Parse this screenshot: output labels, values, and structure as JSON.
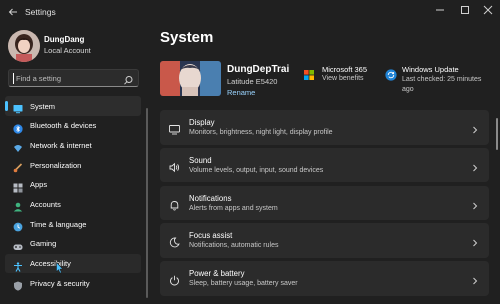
{
  "window": {
    "title": "Settings",
    "back_icon": "back-arrow-icon",
    "controls": [
      "minimize-icon",
      "maximize-icon",
      "close-icon"
    ]
  },
  "profile": {
    "name": "DungDang",
    "account_type": "Local Account"
  },
  "search": {
    "placeholder": "Find a setting"
  },
  "sidebar": {
    "items": [
      {
        "label": "System",
        "icon": "system-icon",
        "color": "#4cc2ff",
        "active": true
      },
      {
        "label": "Bluetooth & devices",
        "icon": "bluetooth-icon",
        "color": "#2f89e8"
      },
      {
        "label": "Network & internet",
        "icon": "network-icon",
        "color": "#5aa9e6"
      },
      {
        "label": "Personalization",
        "icon": "personalization-icon",
        "color": "#d9a060"
      },
      {
        "label": "Apps",
        "icon": "apps-icon",
        "color": "#b7bcc4"
      },
      {
        "label": "Accounts",
        "icon": "accounts-icon",
        "color": "#3fb37f"
      },
      {
        "label": "Time & language",
        "icon": "time-language-icon",
        "color": "#4aa3df"
      },
      {
        "label": "Gaming",
        "icon": "gaming-icon",
        "color": "#b7bcc4"
      },
      {
        "label": "Accessibility",
        "icon": "accessibility-icon",
        "color": "#4cc2ff",
        "hover": true
      },
      {
        "label": "Privacy & security",
        "icon": "privacy-icon",
        "color": "#9aa0a8"
      }
    ]
  },
  "main": {
    "title": "System",
    "device": {
      "name": "DungDepTrai",
      "model": "Latitude E5420",
      "rename_label": "Rename"
    },
    "microsoft365": {
      "title": "Microsoft 365",
      "subtitle": "View benefits"
    },
    "windows_update": {
      "title": "Windows Update",
      "subtitle": "Last checked: 25 minutes ago"
    },
    "cards": [
      {
        "title": "Display",
        "subtitle": "Monitors, brightness, night light, display profile",
        "icon": "display-icon"
      },
      {
        "title": "Sound",
        "subtitle": "Volume levels, output, input, sound devices",
        "icon": "sound-icon"
      },
      {
        "title": "Notifications",
        "subtitle": "Alerts from apps and system",
        "icon": "notifications-icon"
      },
      {
        "title": "Focus assist",
        "subtitle": "Notifications, automatic rules",
        "icon": "focus-assist-icon"
      },
      {
        "title": "Power & battery",
        "subtitle": "Sleep, battery usage, battery saver",
        "icon": "power-icon"
      }
    ]
  },
  "colors": {
    "background": "#202020",
    "card": "#2b2b2b",
    "accent": "#4cc2ff",
    "link": "#9ad4ff"
  }
}
